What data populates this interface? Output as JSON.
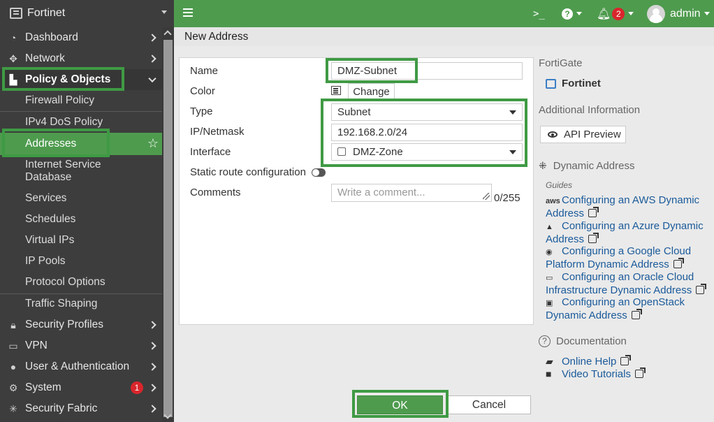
{
  "brand": {
    "name": "Fortinet"
  },
  "sidebar": {
    "items": [
      {
        "label": "Dashboard"
      },
      {
        "label": "Network"
      },
      {
        "label": "Policy & Objects"
      },
      {
        "label": "Firewall Policy"
      },
      {
        "label": "IPv4 DoS Policy"
      },
      {
        "label": "Addresses"
      },
      {
        "label": "Internet Service Database"
      },
      {
        "label": "Services"
      },
      {
        "label": "Schedules"
      },
      {
        "label": "Virtual IPs"
      },
      {
        "label": "IP Pools"
      },
      {
        "label": "Protocol Options"
      },
      {
        "label": "Traffic Shaping"
      },
      {
        "label": "Security Profiles"
      },
      {
        "label": "VPN"
      },
      {
        "label": "User & Authentication"
      },
      {
        "label": "System",
        "badge": "1"
      },
      {
        "label": "Security Fabric"
      }
    ]
  },
  "topbar": {
    "cli_glyph": ">_",
    "help_glyph": "?",
    "notifications_count": "2",
    "user": "admin"
  },
  "page": {
    "title": "New Address"
  },
  "form": {
    "name_label": "Name",
    "name_value": "DMZ-Subnet",
    "color_label": "Color",
    "change_label": "Change",
    "type_label": "Type",
    "type_value": "Subnet",
    "ipmask_label": "IP/Netmask",
    "ipmask_value": "192.168.2.0/24",
    "interface_label": "Interface",
    "interface_value": "DMZ-Zone",
    "static_route_label": "Static route configuration",
    "comments_label": "Comments",
    "comments_placeholder": "Write a comment...",
    "comments_counter": "0/255"
  },
  "info": {
    "fortigate_heading": "FortiGate",
    "fortigate_name": "Fortinet",
    "additional_heading": "Additional Information",
    "api_preview": "API Preview",
    "dynamic_heading": "Dynamic Address",
    "guides_label": "Guides",
    "guides": [
      {
        "icon": "aws",
        "text": "Configuring an AWS Dynamic Address"
      },
      {
        "icon": "▲",
        "text": "Configuring an Azure Dynamic Address"
      },
      {
        "icon": "◉",
        "text": "Configuring a Google Cloud Platform Dynamic Address"
      },
      {
        "icon": "▭",
        "text": "Configuring an Oracle Cloud Infrastructure Dynamic Address"
      },
      {
        "icon": "▣",
        "text": "Configuring an OpenStack Dynamic Address"
      }
    ],
    "documentation_heading": "Documentation",
    "online_help": "Online Help",
    "video_tutorials": "Video Tutorials"
  },
  "buttons": {
    "ok": "OK",
    "cancel": "Cancel"
  },
  "colors": {
    "accent": "#4e9b4e",
    "sidebar_bg": "#3d3d3d",
    "badge": "#d9262c",
    "link": "#1a5a9a"
  }
}
